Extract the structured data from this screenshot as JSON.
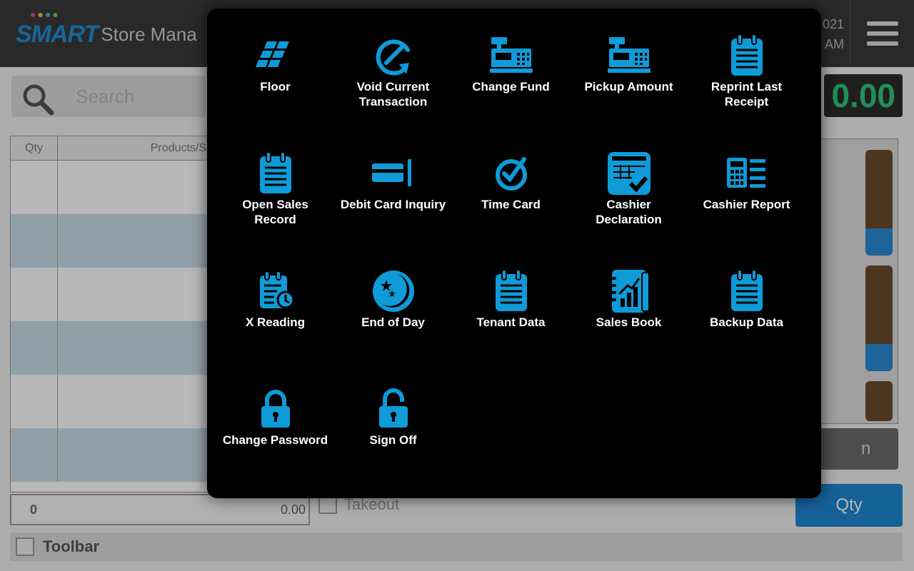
{
  "app": {
    "logo_brand": "SMART",
    "logo_name": "Store Mana",
    "date_fragment": "021",
    "time_fragment": "AM",
    "search_placeholder": "Search",
    "total_fragment": "0.00",
    "grid_headers": {
      "qty": "Qty",
      "products": "Products/Ser"
    },
    "footer": {
      "qty": "0",
      "amount": "0.00"
    },
    "takeout_label": "Takeout",
    "qty_button": "Qty",
    "right_button_fragment": "n",
    "toolbar_label": "Toolbar"
  },
  "menu": {
    "accent": "#0e9bd8",
    "items": [
      {
        "label": "Floor",
        "icon": "floor-icon"
      },
      {
        "label": "Void Current Transaction",
        "icon": "void-icon"
      },
      {
        "label": "Change Fund",
        "icon": "cash-register-icon"
      },
      {
        "label": "Pickup Amount",
        "icon": "cash-register-icon"
      },
      {
        "label": "Reprint Last Receipt",
        "icon": "notepad-icon"
      },
      {
        "label": "Open Sales Record",
        "icon": "notepad-icon"
      },
      {
        "label": "Debit Card Inquiry",
        "icon": "card-icon"
      },
      {
        "label": "Time Card",
        "icon": "clock-check-icon"
      },
      {
        "label": "Cashier Declaration",
        "icon": "declaration-icon"
      },
      {
        "label": "Cashier Report",
        "icon": "calculator-list-icon"
      },
      {
        "label": "X Reading",
        "icon": "notepad-clock-icon"
      },
      {
        "label": "End of Day",
        "icon": "moon-icon"
      },
      {
        "label": "Tenant Data",
        "icon": "notepad-icon"
      },
      {
        "label": "Sales Book",
        "icon": "sales-book-icon"
      },
      {
        "label": "Backup Data",
        "icon": "notepad-icon"
      },
      {
        "label": "Change Password",
        "icon": "lock-icon"
      },
      {
        "label": "Sign Off",
        "icon": "unlock-icon"
      }
    ]
  }
}
